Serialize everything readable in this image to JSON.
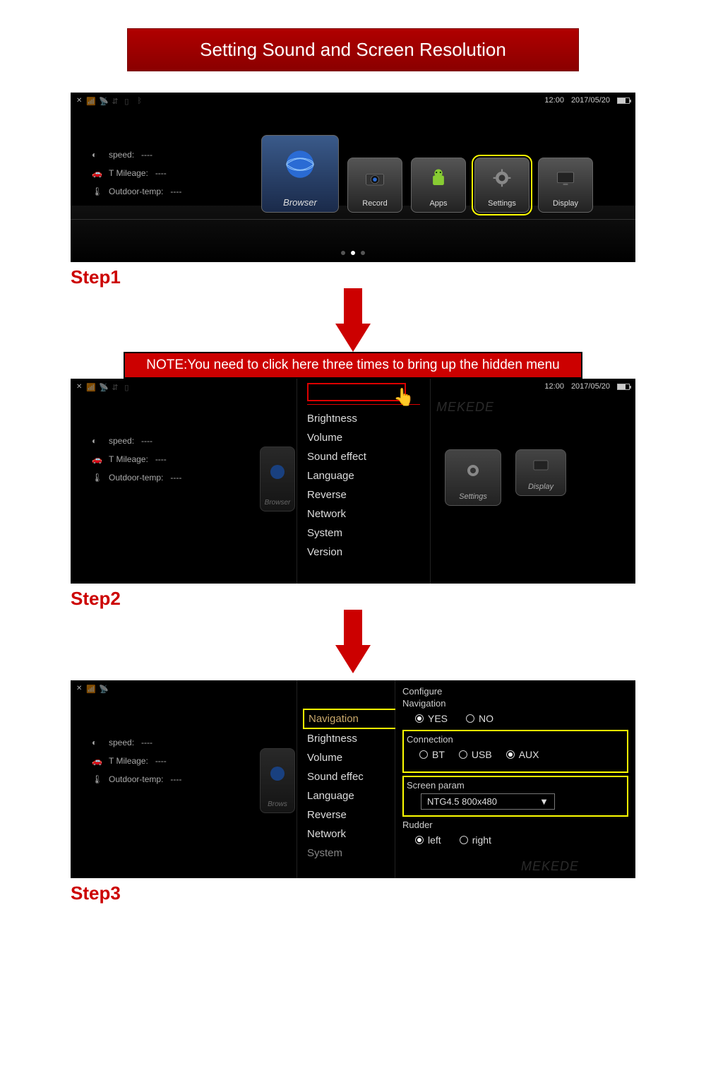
{
  "title": "Setting Sound and Screen Resolution",
  "steps": {
    "s1": "Step1",
    "s2": "Step2",
    "s3": "Step3"
  },
  "note": "NOTE:You need to click here three times to bring up the hidden menu",
  "statusbar": {
    "time": "12:00",
    "date": "2017/05/20"
  },
  "info": {
    "speed_label": "speed:",
    "speed_value": "----",
    "mileage_label": "T Mileage:",
    "mileage_value": "----",
    "outdoor_label": "Outdoor-temp:",
    "outdoor_value": "----"
  },
  "apps": {
    "browser": "Browser",
    "record": "Record",
    "apps": "Apps",
    "settings": "Settings",
    "display": "Display"
  },
  "menu": {
    "navigation": "Navigation",
    "brightness": "Brightness",
    "volume": "Volume",
    "sound_effect": "Sound effect",
    "language": "Language",
    "reverse": "Reverse",
    "network": "Network",
    "system": "System",
    "version": "Version"
  },
  "config": {
    "configure": "Configure",
    "nav_title": "Navigation",
    "yes": "YES",
    "no": "NO",
    "connection_title": "Connection",
    "bt": "BT",
    "usb": "USB",
    "aux": "AUX",
    "screen_title": "Screen param",
    "screen_value": "NTG4.5 800x480",
    "rudder_title": "Rudder",
    "left": "left",
    "right": "right"
  },
  "watermark": "MEKEDE"
}
